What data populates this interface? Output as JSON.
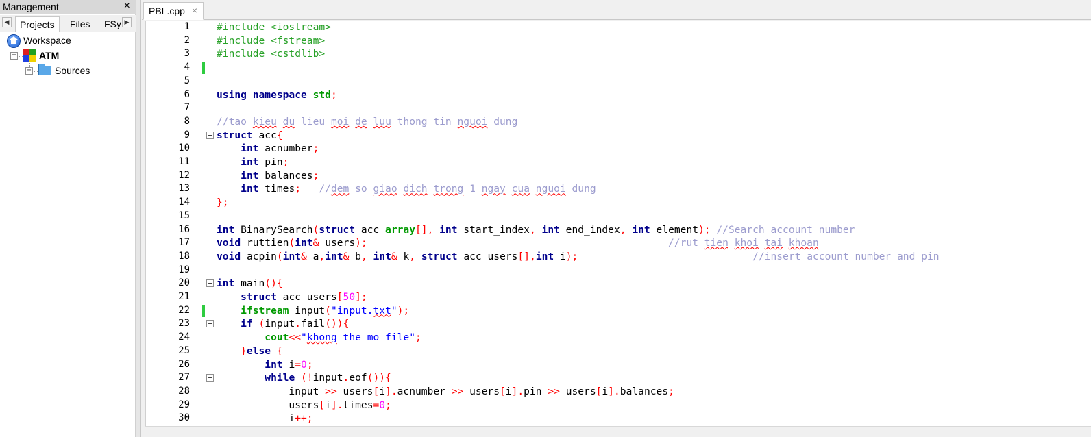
{
  "management": {
    "title": "Management",
    "close": "×",
    "tab_left": "◀",
    "tab_right": "▶",
    "tabs": [
      "Projects",
      "Files",
      "FSy"
    ],
    "tree": {
      "workspace": "Workspace",
      "project": "ATM",
      "folder": "Sources",
      "collapse_symbol": "−",
      "expand_symbol": "+"
    }
  },
  "editor": {
    "file_tab": "PBL.cpp",
    "file_tab_close": "×"
  },
  "icons": {
    "workspace": "workspace-home-icon",
    "project": "project-colored-squares-icon",
    "folder": "folder-icon",
    "fold": "fold-minus-icon"
  },
  "colors": {
    "preprocessor": "#27a127",
    "keyword": "#00008b",
    "namespace": "#009900",
    "operator": "#ff0000",
    "number": "#ff00ff",
    "string": "#0000ff",
    "comment": "#9c9cce",
    "change_bar": "#2ecc40"
  },
  "changed_lines": [
    4,
    22
  ],
  "fold_markers": [
    9,
    20,
    23,
    27
  ],
  "code": [
    [
      [
        "pp",
        "#include <iostream>"
      ]
    ],
    [
      [
        "pp",
        "#include <fstream>"
      ]
    ],
    [
      [
        "pp",
        "#include <cstdlib>"
      ]
    ],
    [],
    [],
    [
      [
        "kw",
        "using namespace "
      ],
      [
        "ns",
        "std"
      ],
      [
        "op",
        ";"
      ]
    ],
    [],
    [
      [
        "cm",
        "//tao "
      ],
      [
        "cmsq",
        "kieu"
      ],
      [
        "cm",
        " "
      ],
      [
        "cmsq",
        "du"
      ],
      [
        "cm",
        " lieu "
      ],
      [
        "cmsq",
        "moi"
      ],
      [
        "cm",
        " "
      ],
      [
        "cmsq",
        "de"
      ],
      [
        "cm",
        " "
      ],
      [
        "cmsq",
        "luu"
      ],
      [
        "cm",
        " thong tin "
      ],
      [
        "cmsq",
        "nguoi"
      ],
      [
        "cm",
        " dung"
      ]
    ],
    [
      [
        "kw",
        "struct"
      ],
      [
        "",
        " acc"
      ],
      [
        "op",
        "{"
      ]
    ],
    [
      [
        "",
        "    "
      ],
      [
        "kw",
        "int"
      ],
      [
        "",
        " acnumber"
      ],
      [
        "op",
        ";"
      ]
    ],
    [
      [
        "",
        "    "
      ],
      [
        "kw",
        "int"
      ],
      [
        "",
        " pin"
      ],
      [
        "op",
        ";"
      ]
    ],
    [
      [
        "",
        "    "
      ],
      [
        "kw",
        "int"
      ],
      [
        "",
        " balances"
      ],
      [
        "op",
        ";"
      ]
    ],
    [
      [
        "",
        "    "
      ],
      [
        "kw",
        "int"
      ],
      [
        "",
        " times"
      ],
      [
        "op",
        ";"
      ],
      [
        "",
        "   "
      ],
      [
        "cm",
        "//"
      ],
      [
        "cmsq",
        "dem"
      ],
      [
        "cm",
        " so "
      ],
      [
        "cmsq",
        "giao"
      ],
      [
        "cm",
        " "
      ],
      [
        "cmsq",
        "dich"
      ],
      [
        "cm",
        " "
      ],
      [
        "cmsq",
        "trong"
      ],
      [
        "cm",
        " 1 "
      ],
      [
        "cmsq",
        "ngay"
      ],
      [
        "cm",
        " "
      ],
      [
        "cmsq",
        "cua"
      ],
      [
        "cm",
        " "
      ],
      [
        "cmsq",
        "nguoi"
      ],
      [
        "cm",
        " dung"
      ]
    ],
    [
      [
        "op",
        "};"
      ]
    ],
    [],
    [
      [
        "kw",
        "int"
      ],
      [
        "",
        " BinarySearch"
      ],
      [
        "op",
        "("
      ],
      [
        "kw",
        "struct"
      ],
      [
        "",
        " acc "
      ],
      [
        "ns",
        "array"
      ],
      [
        "op",
        "[],"
      ],
      [
        "",
        " "
      ],
      [
        "kw",
        "int"
      ],
      [
        "",
        " start_index"
      ],
      [
        "op",
        ","
      ],
      [
        "",
        " "
      ],
      [
        "kw",
        "int"
      ],
      [
        "",
        " end_index"
      ],
      [
        "op",
        ","
      ],
      [
        "",
        " "
      ],
      [
        "kw",
        "int"
      ],
      [
        "",
        " element"
      ],
      [
        "op",
        ");"
      ],
      [
        "",
        " "
      ],
      [
        "cm",
        "//Search account number"
      ]
    ],
    [
      [
        "kw",
        "void"
      ],
      [
        "",
        " ruttien"
      ],
      [
        "op",
        "("
      ],
      [
        "kw",
        "int"
      ],
      [
        "op",
        "&"
      ],
      [
        "",
        " users"
      ],
      [
        "op",
        ");"
      ],
      [
        "",
        "                                                  "
      ],
      [
        "cm",
        "//rut "
      ],
      [
        "cmsq",
        "tien"
      ],
      [
        "cm",
        " "
      ],
      [
        "cmsq",
        "khoi"
      ],
      [
        "cm",
        " "
      ],
      [
        "cmsq",
        "tai"
      ],
      [
        "cm",
        " "
      ],
      [
        "cmsq",
        "khoan"
      ]
    ],
    [
      [
        "kw",
        "void"
      ],
      [
        "",
        " acpin"
      ],
      [
        "op",
        "("
      ],
      [
        "kw",
        "int"
      ],
      [
        "op",
        "&"
      ],
      [
        "",
        " a"
      ],
      [
        "op",
        ","
      ],
      [
        "kw",
        "int"
      ],
      [
        "op",
        "&"
      ],
      [
        "",
        " b"
      ],
      [
        "op",
        ","
      ],
      [
        "",
        " "
      ],
      [
        "kw",
        "int"
      ],
      [
        "op",
        "&"
      ],
      [
        "",
        " k"
      ],
      [
        "op",
        ","
      ],
      [
        "",
        " "
      ],
      [
        "kw",
        "struct"
      ],
      [
        "",
        " acc users"
      ],
      [
        "op",
        "[],"
      ],
      [
        "kw",
        "int"
      ],
      [
        "",
        " i"
      ],
      [
        "op",
        ");"
      ],
      [
        "",
        "                             "
      ],
      [
        "cm",
        "//insert account number and pin"
      ]
    ],
    [],
    [
      [
        "kw",
        "int"
      ],
      [
        "",
        " main"
      ],
      [
        "op",
        "(){"
      ]
    ],
    [
      [
        "",
        "    "
      ],
      [
        "kw",
        "struct"
      ],
      [
        "",
        " acc users"
      ],
      [
        "op",
        "["
      ],
      [
        "num",
        "50"
      ],
      [
        "op",
        "];"
      ]
    ],
    [
      [
        "",
        "    "
      ],
      [
        "ns",
        "ifstream"
      ],
      [
        "",
        " input"
      ],
      [
        "op",
        "("
      ],
      [
        "str",
        "\"input."
      ],
      [
        "strsq",
        "txt"
      ],
      [
        "str",
        "\""
      ],
      [
        "op",
        ");"
      ]
    ],
    [
      [
        "",
        "    "
      ],
      [
        "kw",
        "if"
      ],
      [
        "",
        " "
      ],
      [
        "op",
        "("
      ],
      [
        "",
        "input"
      ],
      [
        "op",
        "."
      ],
      [
        "",
        "fail"
      ],
      [
        "op",
        "()){"
      ]
    ],
    [
      [
        "",
        "        "
      ],
      [
        "ns",
        "cout"
      ],
      [
        "op",
        "<<"
      ],
      [
        "str",
        "\""
      ],
      [
        "strsq",
        "khong"
      ],
      [
        "str",
        " the mo file\""
      ],
      [
        "op",
        ";"
      ]
    ],
    [
      [
        "",
        "    "
      ],
      [
        "op",
        "}"
      ],
      [
        "kw",
        "else"
      ],
      [
        "",
        " "
      ],
      [
        "op",
        "{"
      ]
    ],
    [
      [
        "",
        "        "
      ],
      [
        "kw",
        "int"
      ],
      [
        "",
        " i"
      ],
      [
        "op",
        "="
      ],
      [
        "num",
        "0"
      ],
      [
        "op",
        ";"
      ]
    ],
    [
      [
        "",
        "        "
      ],
      [
        "kw",
        "while"
      ],
      [
        "",
        " "
      ],
      [
        "op",
        "(!"
      ],
      [
        "",
        "input"
      ],
      [
        "op",
        "."
      ],
      [
        "",
        "eof"
      ],
      [
        "op",
        "()){"
      ]
    ],
    [
      [
        "",
        "            input "
      ],
      [
        "op",
        ">>"
      ],
      [
        "",
        " users"
      ],
      [
        "op",
        "["
      ],
      [
        "",
        "i"
      ],
      [
        "op",
        "]."
      ],
      [
        "",
        "acnumber "
      ],
      [
        "op",
        ">>"
      ],
      [
        "",
        " users"
      ],
      [
        "op",
        "["
      ],
      [
        "",
        "i"
      ],
      [
        "op",
        "]."
      ],
      [
        "",
        "pin "
      ],
      [
        "op",
        ">>"
      ],
      [
        "",
        " users"
      ],
      [
        "op",
        "["
      ],
      [
        "",
        "i"
      ],
      [
        "op",
        "]."
      ],
      [
        "",
        "balances"
      ],
      [
        "op",
        ";"
      ]
    ],
    [
      [
        "",
        "            users"
      ],
      [
        "op",
        "["
      ],
      [
        "",
        "i"
      ],
      [
        "op",
        "]."
      ],
      [
        "",
        "times"
      ],
      [
        "op",
        "="
      ],
      [
        "num",
        "0"
      ],
      [
        "op",
        ";"
      ]
    ],
    [
      [
        "",
        "            i"
      ],
      [
        "op",
        "++;"
      ]
    ]
  ]
}
